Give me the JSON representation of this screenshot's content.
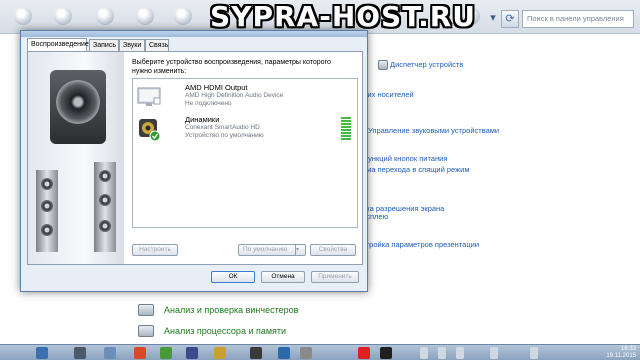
{
  "watermark": "SYPRA-HOST.RU",
  "search": {
    "placeholder": "Поиск в панели управления"
  },
  "control_panel": {
    "links": [
      "Диспетчер устройств",
      "тих носителей",
      "Управление звуковыми устройствами",
      "функций кнопок питания",
      "йма перехода в спящий режим",
      "йка разрешения экрана",
      "исплею",
      "стройка параметров презентации"
    ],
    "sections": [
      "Анализ и проверка винчестеров",
      "Анализ процессора и памяти"
    ]
  },
  "dialog": {
    "tabs": [
      "Воспроизведение",
      "Запись",
      "Звуки",
      "Связь"
    ],
    "active_tab": "Воспроизведение",
    "instructions": "Выберите устройство воспроизведения, параметры которого нужно изменить:",
    "devices": [
      {
        "name": "AMD HDMI Output",
        "driver": "AMD High Definition Audio Device",
        "status": "Не подключено",
        "icon": "monitor-icon"
      },
      {
        "name": "Динамики",
        "driver": "Conexant SmartAudio HD",
        "status": "Устройство по умолчанию",
        "icon": "speaker-icon"
      }
    ],
    "buttons": {
      "configure": "Настроить",
      "set_default": "По умолчанию",
      "properties": "Свойства",
      "ok": "ОК",
      "cancel": "Отмена",
      "apply": "Применить"
    }
  },
  "taskbar": {
    "time": "18:33",
    "date": "19.11.2015"
  }
}
